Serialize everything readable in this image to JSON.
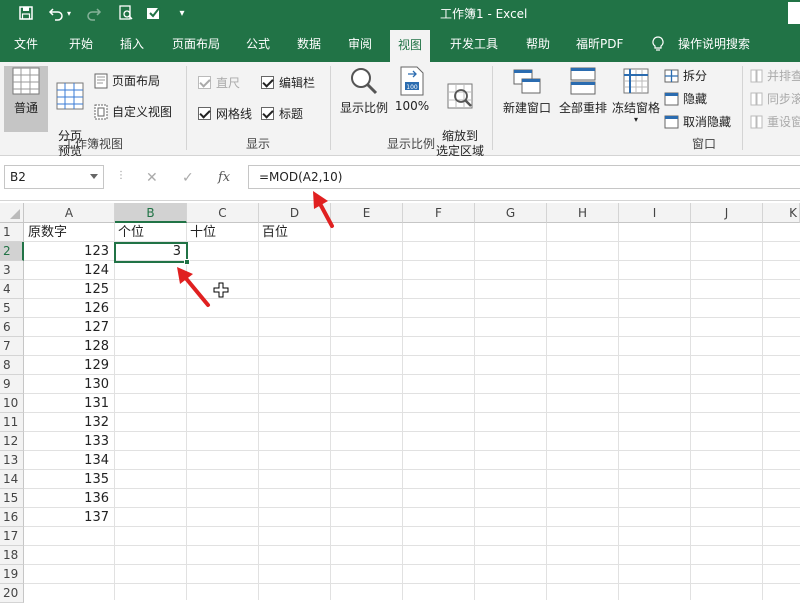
{
  "window": {
    "title": "工作簿1  -  Excel"
  },
  "tabs": [
    "文件",
    "开始",
    "插入",
    "页面布局",
    "公式",
    "数据",
    "审阅",
    "视图",
    "开发工具",
    "帮助",
    "福昕PDF",
    "操作说明搜索"
  ],
  "active_tab": "视图",
  "ribbon": {
    "workbook_views": {
      "label": "工作簿视图",
      "normal": "普通",
      "page_break": "分页\n预览",
      "page_layout": "页面布局",
      "custom_view": "自定义视图"
    },
    "show": {
      "label": "显示",
      "ruler": "直尺",
      "formula_bar": "编辑栏",
      "gridlines": "网格线",
      "headings": "标题"
    },
    "zoom": {
      "label": "显示比例",
      "zoom": "显示比例",
      "hundred": "100%",
      "zoom_to_selection": "缩放到\n选定区域"
    },
    "window": {
      "label": "窗口",
      "new_window": "新建窗口",
      "arrange_all": "全部重排",
      "freeze_panes": "冻结窗格",
      "split": "拆分",
      "hide": "隐藏",
      "unhide": "取消隐藏",
      "side_by_side": "并排查",
      "sync_scroll": "同步滚",
      "reset_position": "重设窗"
    }
  },
  "formula_bar": {
    "name_box": "B2",
    "formula": "=MOD(A2,10)",
    "fx_label": "fx"
  },
  "sheet": {
    "columns": [
      "A",
      "B",
      "C",
      "D",
      "E",
      "F",
      "G",
      "H",
      "I",
      "J",
      "K"
    ],
    "rows": [
      "1",
      "2",
      "3",
      "4",
      "5",
      "6",
      "7",
      "8",
      "9",
      "10",
      "11",
      "12",
      "13",
      "14",
      "15",
      "16",
      "17",
      "18",
      "19",
      "20"
    ],
    "headers": {
      "A1": "原数字",
      "B1": "个位",
      "C1": "十位",
      "D1": "百位"
    },
    "a_values": [
      "123",
      "124",
      "125",
      "126",
      "127",
      "128",
      "129",
      "130",
      "131",
      "132",
      "133",
      "134",
      "135",
      "136",
      "137"
    ],
    "b2_value": "3",
    "selected_cell": "B2"
  },
  "colors": {
    "accent": "#217346",
    "annotation_arrow": "#e02020"
  }
}
